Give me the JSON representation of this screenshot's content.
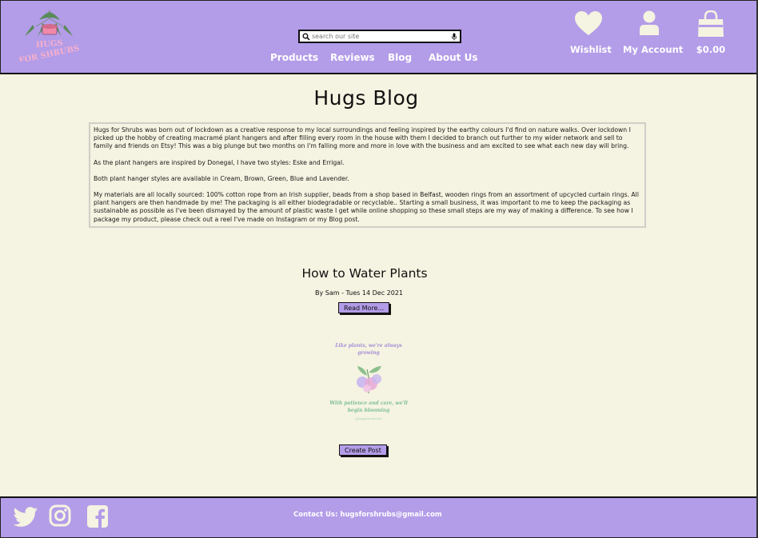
{
  "header": {
    "logo_text": "HUGS FOR SHRUBS",
    "search": {
      "placeholder": "search our site"
    },
    "nav": [
      {
        "label": "Products"
      },
      {
        "label": "Reviews"
      },
      {
        "label": "Blog"
      },
      {
        "label": "About Us"
      }
    ],
    "wishlist_label": "Wishlist",
    "account_label": "My Account",
    "cart_total": "$0.00"
  },
  "page": {
    "title": "Hugs Blog",
    "about": [
      "Hugs for Shrubs was born out of lockdown as a creative response to my local surroundings and feeling inspired by the earthy colours I'd find on nature walks. Over lockdown I picked up  the hobby of creating macramé plant hangers and after filling every room in the house with them I decided to branch out further to my wider network and sell to family and friends on Etsy! This was a big plunge but two months on I'm falling more and more in love with the business and am excited to see what each new day will bring.",
      "As the plant hangers are inspired by Donegal, I have two styles: Eske and Errigal.",
      "Both plant hanger styles are available in Cream, Brown, Green, Blue and Lavender.",
      "My materials are all locally sourced: 100% cotton rope from an Irish supplier, beads from a shop based in Belfast, wooden rings from an assortment of upcycled curtain rings. All plant hangers are then handmade by me! The packaging is all either biodegradable or recyclable.. Starting a small business, it was important to me to keep the packaging as sustainable as possible as I've been dismayed by the amount of plastic waste I get while online shopping so these small steps are my way of making a difference. To see how I package my product, please check out a reel I've made on Instagram or my Blog post."
    ]
  },
  "post": {
    "title": "How to Water Plants",
    "meta": "By Sam - Tues 14 Dec 2021",
    "read_more": "Read More...",
    "image_text_top": "Like plants, we're always growing",
    "image_text_bottom": "With patience and care, we'll begin blooming",
    "image_handle": "@hugsforshrubs"
  },
  "create_post_label": "Create Post",
  "footer": {
    "contact_label": "Contact Us:",
    "contact_email": "hugsforshrubs@gmail.com",
    "social": [
      "twitter-icon",
      "instagram-icon",
      "facebook-icon"
    ]
  },
  "colors": {
    "accent": "#b39ce8",
    "background": "#f5f3e1",
    "logo_pink": "#f4a6c6"
  }
}
